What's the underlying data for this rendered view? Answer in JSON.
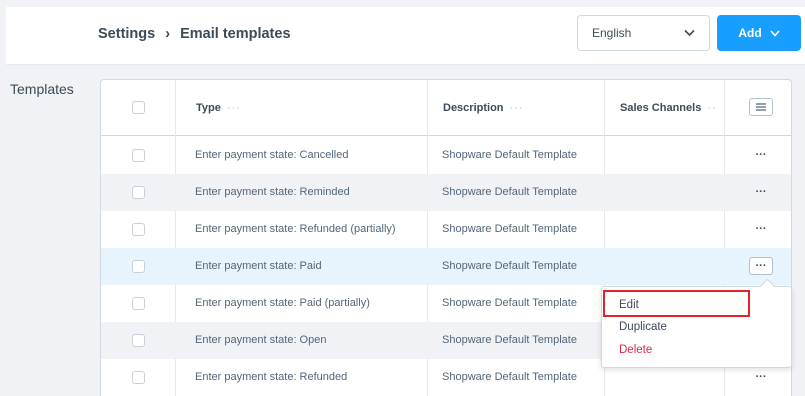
{
  "header": {
    "breadcrumb_parent": "Settings",
    "breadcrumb_separator": "›",
    "breadcrumb_current": "Email templates",
    "language_select": {
      "value": "English"
    },
    "add_button_label": "Add"
  },
  "sidebar": {
    "title": "Templates"
  },
  "grid": {
    "columns": [
      {
        "label": "Type",
        "dots": "···"
      },
      {
        "label": "Description",
        "dots": "···"
      },
      {
        "label": "Sales Channels",
        "dots": "··"
      }
    ],
    "rows": [
      {
        "type": "Enter payment state: Cancelled",
        "description": "Shopware Default Template",
        "sales_channels": "",
        "action": "···"
      },
      {
        "type": "Enter payment state: Reminded",
        "description": "Shopware Default Template",
        "sales_channels": "",
        "action": "···"
      },
      {
        "type": "Enter payment state: Refunded (partially)",
        "description": "Shopware Default Template",
        "sales_channels": "",
        "action": "···"
      },
      {
        "type": "Enter payment state: Paid",
        "description": "Shopware Default Template",
        "sales_channels": "",
        "action": "···"
      },
      {
        "type": "Enter payment state: Paid (partially)",
        "description": "Shopware Default Template",
        "sales_channels": "",
        "action": ""
      },
      {
        "type": "Enter payment state: Open",
        "description": "Shopware Default Template",
        "sales_channels": "",
        "action": ""
      },
      {
        "type": "Enter payment state: Refunded",
        "description": "Shopware Default Template",
        "sales_channels": "",
        "action": "···"
      }
    ]
  },
  "context_menu": {
    "edit": "Edit",
    "duplicate": "Duplicate",
    "delete": "Delete"
  },
  "colors": {
    "primary": "#189eff",
    "danger": "#de294c",
    "highlight_box": "#e0242b",
    "row_hover": "#e8f4fd"
  },
  "icons": {
    "chevron": "chevron-down-icon",
    "column_settings": "list-settings-icon"
  }
}
